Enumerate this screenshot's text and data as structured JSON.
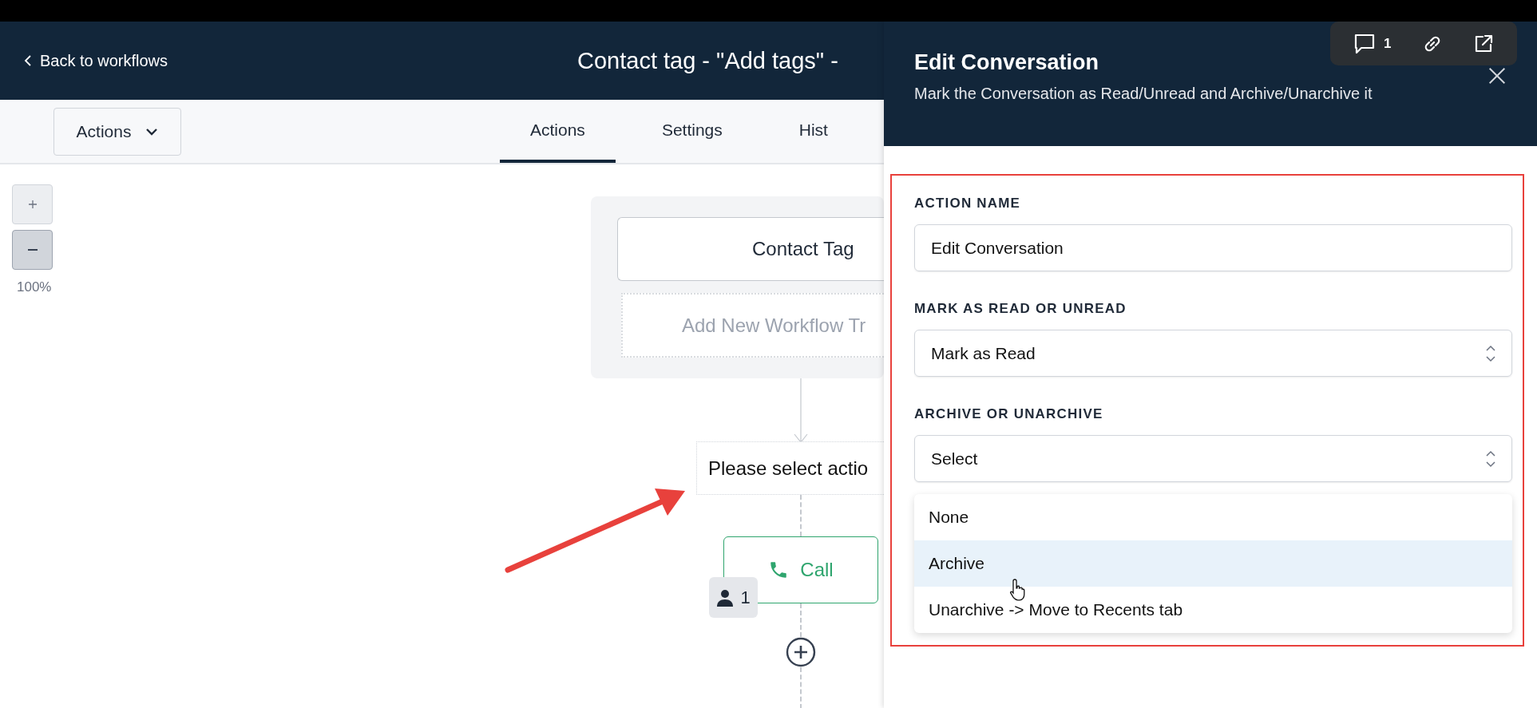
{
  "header": {
    "back_link": "Back to workflows",
    "title": "Contact tag - \"Add tags\" -"
  },
  "toolbar": {
    "actions_menu": "Actions",
    "tabs": [
      {
        "label": "Actions",
        "selected": true
      },
      {
        "label": "Settings",
        "selected": false
      },
      {
        "label": "Hist",
        "selected": false
      }
    ]
  },
  "canvas": {
    "zoom_level": "100%",
    "trigger": "Contact Tag",
    "add_trigger": "Add New Workflow Tr",
    "action_placeholder": "Please select actio",
    "call_step": {
      "label": "Call",
      "contacts": "1"
    }
  },
  "panel": {
    "title": "Edit Conversation",
    "subtitle": "Mark the Conversation as Read/Unread and Archive/Unarchive it",
    "comment_count": "1",
    "fields": [
      {
        "kind": "text",
        "label": "ACTION NAME",
        "value": "Edit Conversation"
      },
      {
        "kind": "select",
        "label": "MARK AS READ OR UNREAD",
        "value": "Mark as Read"
      },
      {
        "kind": "select",
        "label": "ARCHIVE OR UNARCHIVE",
        "value": "Select",
        "options": [
          {
            "label": "None",
            "selected": false
          },
          {
            "label": "Archive",
            "selected": true
          },
          {
            "label": "Unarchive -> Move to Recents tab",
            "selected": false
          }
        ]
      }
    ]
  }
}
